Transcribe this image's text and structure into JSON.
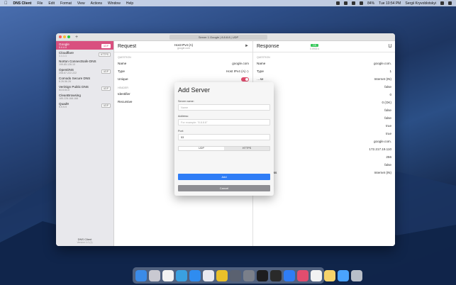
{
  "menubar": {
    "app_name": "DNS Client",
    "menus": [
      "File",
      "Edit",
      "Format",
      "View",
      "Actions",
      "Window",
      "Help"
    ],
    "battery": "84%",
    "clock": "Tue 10:54 PM",
    "user": "Sergii Kryvoblotskyi"
  },
  "window": {
    "tab_title": "Server 1 Google | 8.8.8.8 | UDP"
  },
  "sidebar": {
    "servers": [
      {
        "name": "Google",
        "ip": "8.8.8.8",
        "protocol": "UDP",
        "selected": true
      },
      {
        "name": "Cloudflare",
        "ip": "1.1.1.1",
        "protocol": "HTTPS",
        "selected": false
      },
      {
        "name": "Norton ConnectSafe DNS",
        "ip": "199.85.126.10",
        "protocol": "",
        "selected": false
      },
      {
        "name": "OpenDNS",
        "ip": "208.67.222.222",
        "protocol": "UDP",
        "selected": false
      },
      {
        "name": "Comodo Secure DNS",
        "ip": "8.26.56.26",
        "protocol": "",
        "selected": false
      },
      {
        "name": "VeriSign Public DNS",
        "ip": "64.6.64.6",
        "protocol": "UDP",
        "selected": false
      },
      {
        "name": "CleanBrowsing",
        "ip": "185.228.168.168",
        "protocol": "",
        "selected": false
      },
      {
        "name": "Quad9",
        "ip": "9.9.9.9",
        "protocol": "UDP",
        "selected": false
      }
    ],
    "footer_title": "DNS Client",
    "footer_version": "Version 1.0 (1)"
  },
  "request": {
    "title": "Request",
    "host_main": "Host IPv4 (A)",
    "host_sub": "google.com",
    "question_header": "QUESTION",
    "rows": [
      {
        "label": "Name",
        "value": "google.com"
      },
      {
        "label": "Type",
        "value": "Host IPv4 (A) ◇"
      },
      {
        "label": "Unique",
        "value": ""
      }
    ],
    "header_header": "HEADER",
    "header_rows": [
      {
        "label": "Identifier",
        "value": ""
      },
      {
        "label": "Recursive",
        "value": ""
      }
    ]
  },
  "response": {
    "title": "Response",
    "status_badge": "OK",
    "status_time": "0.0933 s",
    "question_header": "QUESTION",
    "rows": [
      {
        "label": "Name",
        "value": "google.com."
      },
      {
        "label": "Type",
        "value": "1"
      },
      {
        "label": "…se",
        "value": "Internet (IN)"
      },
      {
        "label": "",
        "value": "false"
      },
      {
        "label": "",
        "value": "0"
      },
      {
        "label": "…s",
        "value": "0 (OK)"
      },
      {
        "label": "…e Answer",
        "value": "false"
      },
      {
        "label": "",
        "value": "false"
      },
      {
        "label": "…sired",
        "value": "true"
      },
      {
        "label": "…ailable",
        "value": "true"
      },
      {
        "label": "",
        "value": "google.com."
      },
      {
        "label": "",
        "value": "172.217.19.110"
      },
      {
        "label": "",
        "value": "256"
      },
      {
        "label": "",
        "value": "false"
      },
      {
        "label": "Internet Class",
        "value": "Internet (IN)"
      }
    ]
  },
  "dialog": {
    "title": "Add Server",
    "server_name_label": "Server name:",
    "server_name_placeholder": "Name",
    "address_label": "Address:",
    "address_placeholder": "For example: \"8.8.8.8\"",
    "port_label": "Port:",
    "port_value": "53",
    "protocols": [
      "UDP",
      "HTTPS"
    ],
    "add_label": "Add",
    "cancel_label": "Cancel"
  },
  "dock": {
    "icons": [
      "finder-icon",
      "launchpad-icon",
      "calendar-icon",
      "preview-icon",
      "safari-icon",
      "compass-icon",
      "chrome-icon",
      "xcode-icon",
      "tools-icon",
      "dns-client-icon",
      "terminal-icon",
      "blue-app-icon",
      "slack-icon",
      "photos-icon",
      "notes-icon",
      "files-icon",
      "trash-icon"
    ],
    "colors": [
      "#3b8be8",
      "#c9c9d1",
      "#f2f2f2",
      "#3aa0e0",
      "#2f8cf0",
      "#e9e9ef",
      "#e9c02a",
      "#5a6170",
      "#7a7f8a",
      "#1d1d1f",
      "#2a2a2a",
      "#2f7df6",
      "#e24d6e",
      "#f2f2f2",
      "#f6d36a",
      "#4aa3ff",
      "#b8bec8"
    ]
  },
  "colors": {
    "accent_pink": "#d9507f",
    "accent_blue": "#2f7df6",
    "status_green": "#34c759"
  }
}
